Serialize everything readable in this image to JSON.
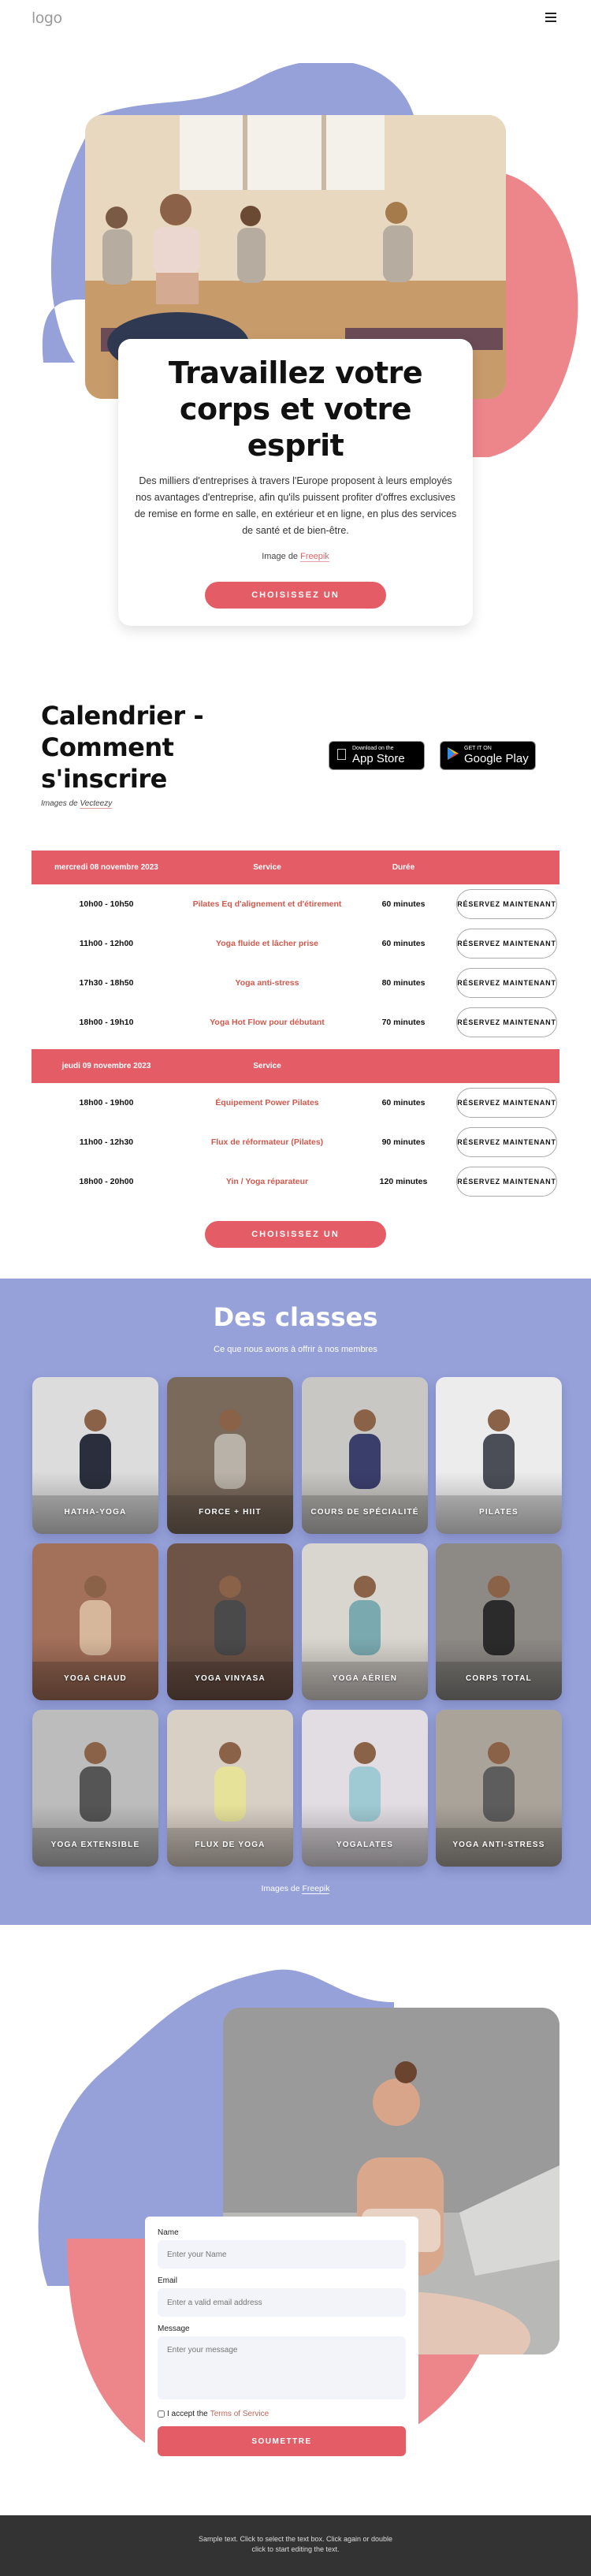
{
  "header": {
    "logo": "logo",
    "menu_icon": "hamburger-menu-icon"
  },
  "hero": {
    "title": "Travaillez votre corps et votre esprit",
    "text": "Des milliers d'entreprises à travers l'Europe proposent à leurs employés nos avantages d'entreprise, afin qu'ils puissent profiter d'offres exclusives de remise en forme en salle, en extérieur et en ligne, en plus des services de santé et de bien-être.",
    "credit_prefix": "Image de",
    "credit_link": "Freepik",
    "cta": "CHOISISSEZ UN ABONNEMENT"
  },
  "calendar": {
    "title_lines": [
      "Calendrier -",
      "Comment",
      "s'inscrire"
    ],
    "credit_prefix": "Images de",
    "credit_link": "Vecteezy",
    "app_store": {
      "small": "Download on the",
      "big": "App Store"
    },
    "google_play": {
      "small": "GET IT ON",
      "big": "Google Play"
    },
    "days": [
      {
        "date": "mercredi 08 novembre 2023",
        "col_service": "Service",
        "col_duration": "Durée",
        "rows": [
          {
            "time": "10h00 - 10h50",
            "service": "Pilates Eq d'alignement et d'étirement",
            "duration": "60 minutes",
            "action": "RÉSERVEZ MAINTENANT"
          },
          {
            "time": "11h00 - 12h00",
            "service": "Yoga fluide et lâcher prise",
            "duration": "60 minutes",
            "action": "RÉSERVEZ MAINTENANT"
          },
          {
            "time": "17h30 - 18h50",
            "service": "Yoga anti-stress",
            "duration": "80 minutes",
            "action": "RÉSERVEZ MAINTENANT"
          },
          {
            "time": "18h00 - 19h10",
            "service": "Yoga Hot Flow pour débutant",
            "duration": "70 minutes",
            "action": "RÉSERVEZ MAINTENANT"
          }
        ]
      },
      {
        "date": "jeudi 09 novembre 2023",
        "col_service": "Service",
        "col_duration": "",
        "rows": [
          {
            "time": "18h00 - 19h00",
            "service": "Équipement Power Pilates",
            "duration": "60 minutes",
            "action": "RÉSERVEZ MAINTENANT"
          },
          {
            "time": "11h00 - 12h30",
            "service": "Flux de réformateur (Pilates)",
            "duration": "90 minutes",
            "action": "RÉSERVEZ MAINTENANT"
          },
          {
            "time": "18h00 - 20h00",
            "service": "Yin / Yoga réparateur",
            "duration": "120 minutes",
            "action": "RÉSERVEZ MAINTENANT"
          }
        ]
      }
    ],
    "cta": "CHOISISSEZ UN ABONNEMENT"
  },
  "classes": {
    "title": "Des classes",
    "subtitle": "Ce que nous avons à offrir à nos membres",
    "items": [
      "HATHA-YOGA",
      "FORCE + HIIT",
      "COURS DE SPÉCIALITÉ",
      "PILATES",
      "YOGA CHAUD",
      "YOGA VINYASA",
      "YOGA AÉRIEN",
      "CORPS TOTAL",
      "YOGA EXTENSIBLE",
      "FLUX DE YOGA",
      "YOGALATES",
      "YOGA ANTI-STRESS"
    ],
    "credit_prefix": "Images de",
    "credit_link": "Freepik"
  },
  "contact": {
    "name_label": "Name",
    "name_placeholder": "Enter your Name",
    "email_label": "Email",
    "email_placeholder": "Enter a valid email address",
    "message_label": "Message",
    "message_placeholder": "Enter your message",
    "accept_prefix": "I accept the",
    "accept_link": "Terms of Service",
    "submit": "SOUMETTRE"
  },
  "footer": {
    "text": "Sample text. Click to select the text box. Click again or double click to start editing the text."
  },
  "colors": {
    "accent": "#e45c66",
    "lavender": "#96a1d9",
    "coral": "#ec868b",
    "footer_bg": "#333333"
  }
}
